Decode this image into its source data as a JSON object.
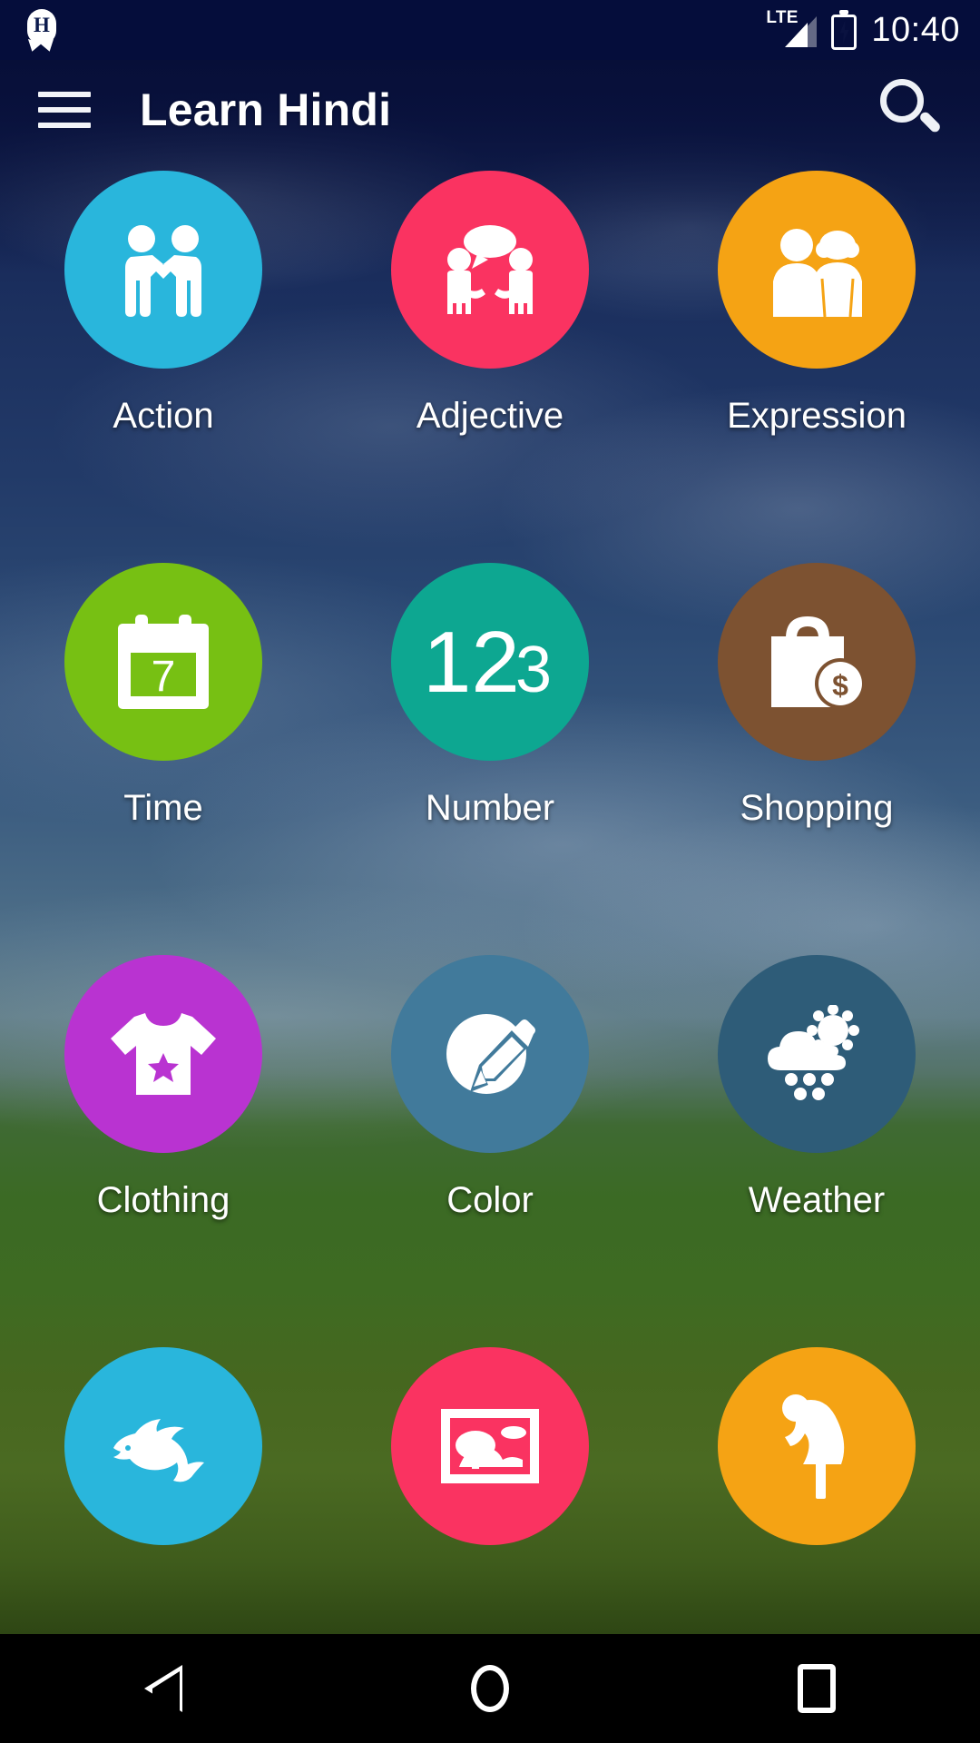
{
  "status_bar": {
    "notification_badge_letter": "H",
    "notification_icon": "app-notification-badge-icon",
    "network_type": "LTE",
    "signal_icon": "signal-bars-icon",
    "battery_icon": "battery-charging-icon",
    "time": "10:40"
  },
  "app_bar": {
    "menu_icon": "hamburger-menu-icon",
    "title": "Learn Hindi",
    "search_icon": "search-icon"
  },
  "colors": {
    "status_bar_bg": "#050d3b",
    "nav_bar_bg": "#000000",
    "label_text": "#ffffff",
    "action": "#29b6dc",
    "adjective": "#fa3361",
    "expression": "#f5a314",
    "time": "#77c013",
    "number": "#0da791",
    "shopping": "#7d5231",
    "clothing": "#b933d1",
    "color": "#417a9b",
    "weather": "#2e5c78",
    "animal": "#29b6dc",
    "nature": "#fa3361",
    "body": "#f5a314"
  },
  "grid": {
    "tiles": [
      {
        "label": "Action",
        "icon": "handshake-people-icon",
        "color": "#29b6dc"
      },
      {
        "label": "Adjective",
        "icon": "people-speech-bubble-icon",
        "color": "#fa3361"
      },
      {
        "label": "Expression",
        "icon": "couple-man-woman-icon",
        "color": "#f5a314"
      },
      {
        "label": "Time",
        "icon": "calendar-day-7-icon",
        "color": "#77c013",
        "glyph": "7"
      },
      {
        "label": "Number",
        "icon": "numbers-123-icon",
        "color": "#0da791",
        "glyph": "123"
      },
      {
        "label": "Shopping",
        "icon": "shopping-bag-dollar-icon",
        "color": "#7d5231"
      },
      {
        "label": "Clothing",
        "icon": "tshirt-star-icon",
        "color": "#b933d1"
      },
      {
        "label": "Color",
        "icon": "palette-pencil-icon",
        "color": "#417a9b"
      },
      {
        "label": "Weather",
        "icon": "sun-cloud-snow-icon",
        "color": "#2e5c78"
      },
      {
        "label": "",
        "icon": "dolphin-icon",
        "color": "#29b6dc"
      },
      {
        "label": "",
        "icon": "landscape-picture-icon",
        "color": "#fa3361"
      },
      {
        "label": "",
        "icon": "bending-person-icon",
        "color": "#f5a314"
      }
    ]
  },
  "nav_bar": {
    "back_icon": "back-triangle-icon",
    "home_icon": "home-circle-icon",
    "recents_icon": "recents-square-icon"
  }
}
